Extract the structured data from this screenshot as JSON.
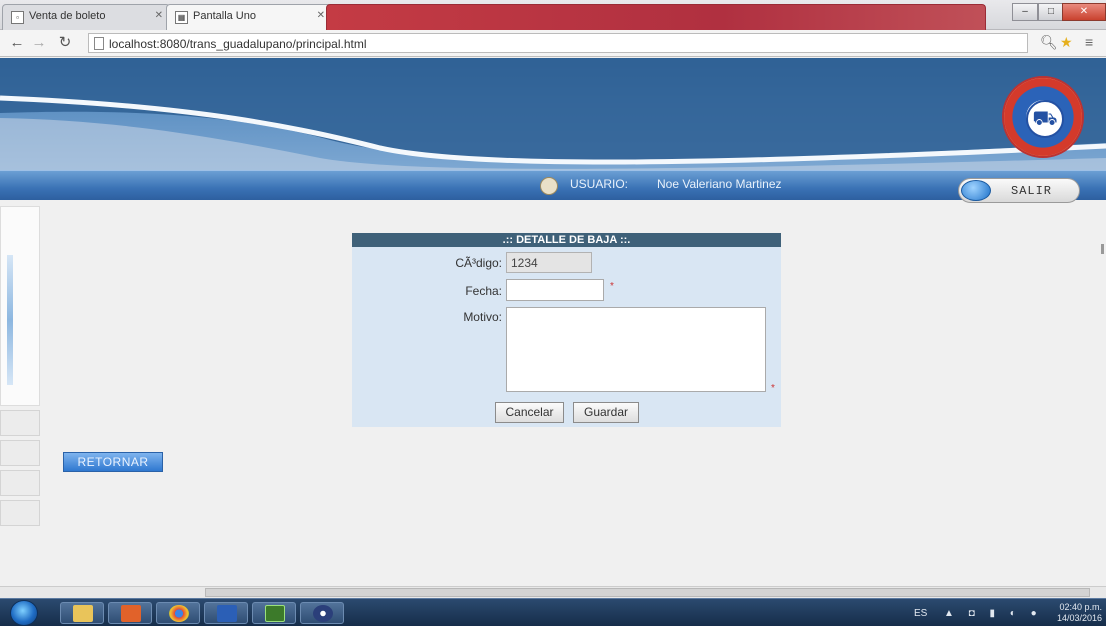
{
  "browser": {
    "tabs": [
      {
        "title": "Venta de boleto"
      },
      {
        "title": "Pantalla Uno"
      }
    ],
    "window_controls": {
      "minimize": "–",
      "maximize": "□",
      "close": "✕"
    },
    "url": "localhost:8080/trans_guadalupano/principal.html"
  },
  "header": {
    "user_label": "USUARIO:",
    "user_name": "Noe Valeriano Martinez",
    "logout_label": "SALIR"
  },
  "form": {
    "title": ".:: DETALLE DE BAJA ::.",
    "codigo_label": "CÃ³digo:",
    "codigo_value": "1234",
    "fecha_label": "Fecha:",
    "fecha_value": "",
    "motivo_label": "Motivo:",
    "motivo_value": "",
    "required_mark": "*",
    "cancel_label": "Cancelar",
    "save_label": "Guardar"
  },
  "page": {
    "return_label": "RETORNAR"
  },
  "taskbar": {
    "apps": [
      "explorer-icon",
      "media-player-icon",
      "chrome-icon",
      "word-icon",
      "dreamweaver-icon",
      "eclipse-icon"
    ],
    "language": "ES",
    "time": "02:40 p.m.",
    "date": "14/03/2016"
  }
}
